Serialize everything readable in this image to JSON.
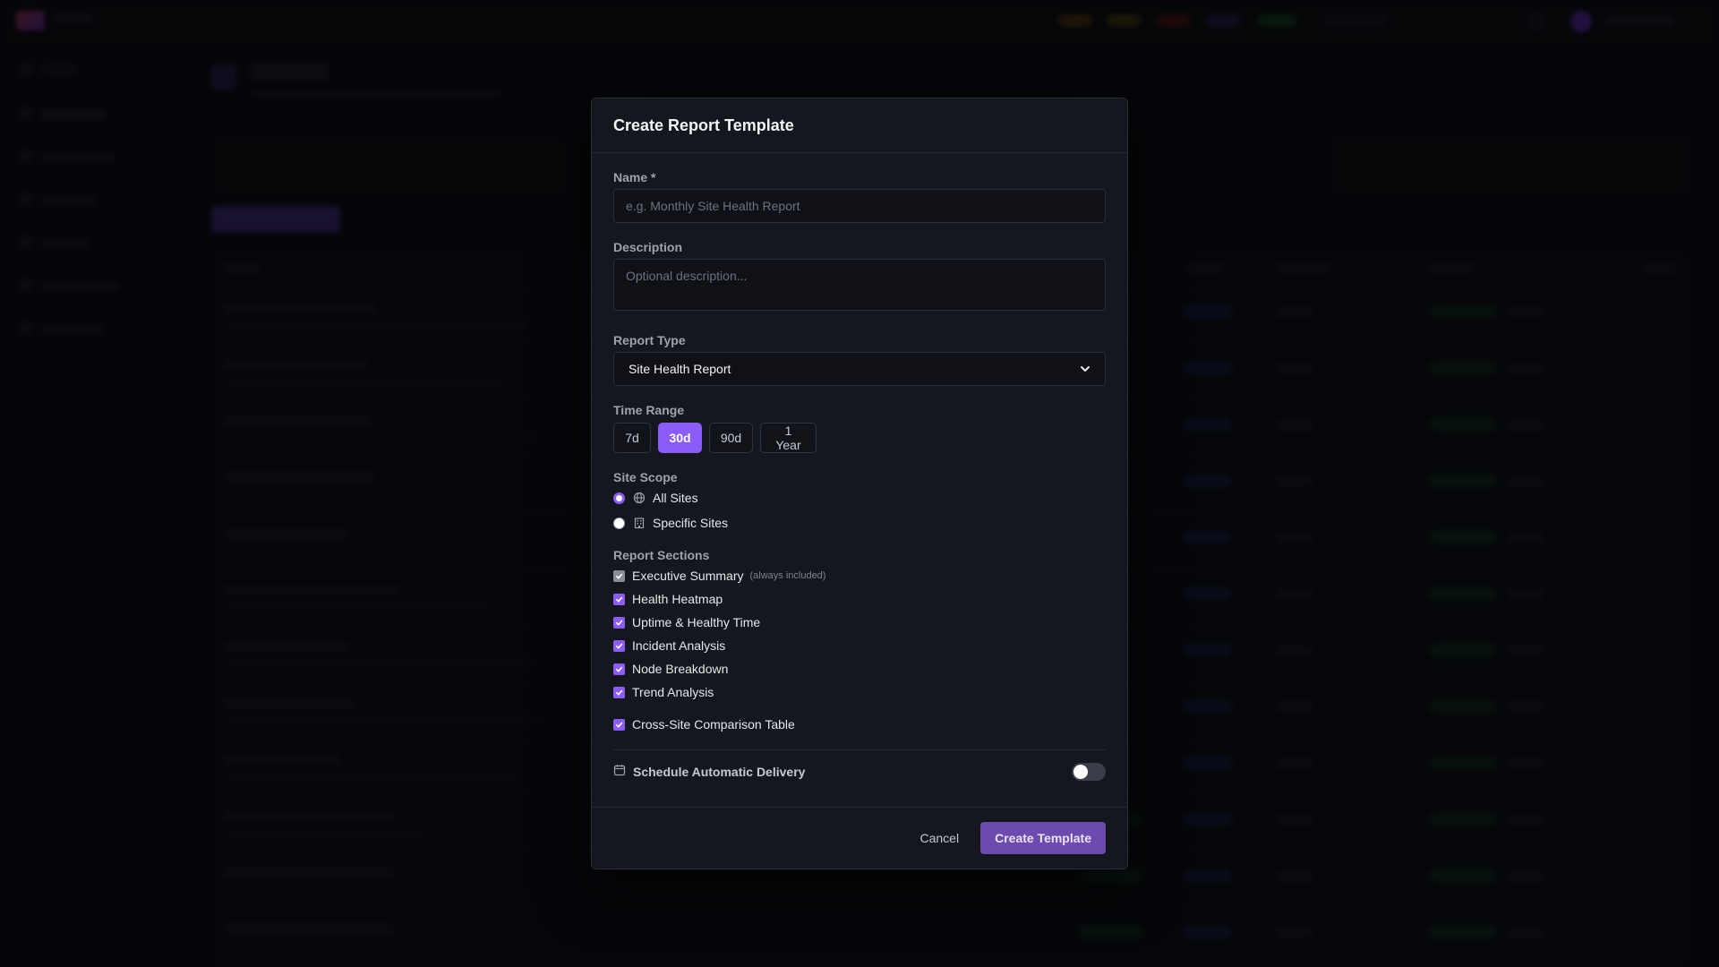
{
  "modal": {
    "title": "Create Report Template",
    "name": {
      "label": "Name *",
      "placeholder": "e.g. Monthly Site Health Report",
      "value": ""
    },
    "description": {
      "label": "Description",
      "placeholder": "Optional description...",
      "value": ""
    },
    "report_type": {
      "label": "Report Type",
      "selected": "Site Health Report"
    },
    "time_range": {
      "label": "Time Range",
      "options": [
        "7d",
        "30d",
        "90d",
        "1 Year"
      ],
      "selected": "30d"
    },
    "site_scope": {
      "label": "Site Scope",
      "options": [
        {
          "label": "All Sites",
          "icon": "globe-icon",
          "checked": true
        },
        {
          "label": "Specific Sites",
          "icon": "building-icon",
          "checked": false
        }
      ]
    },
    "sections": {
      "label": "Report Sections",
      "items": [
        {
          "label": "Executive Summary",
          "note": "(always included)",
          "checked": true,
          "disabled": true
        },
        {
          "label": "Health Heatmap",
          "checked": true
        },
        {
          "label": "Uptime & Healthy Time",
          "checked": true
        },
        {
          "label": "Incident Analysis",
          "checked": true
        },
        {
          "label": "Node Breakdown",
          "checked": true
        },
        {
          "label": "Trend Analysis",
          "checked": true
        },
        {
          "label": "Cross-Site Comparison Table",
          "checked": true
        }
      ]
    },
    "schedule": {
      "label": "Schedule Automatic Delivery",
      "icon": "calendar-icon",
      "enabled": false
    },
    "footer": {
      "cancel_label": "Cancel",
      "create_label": "Create Template"
    }
  },
  "colors": {
    "accent": "#8b5cf6",
    "primary_button": "#6d4aae",
    "modal_bg": "#14171e",
    "backdrop": "#0b0d12"
  }
}
